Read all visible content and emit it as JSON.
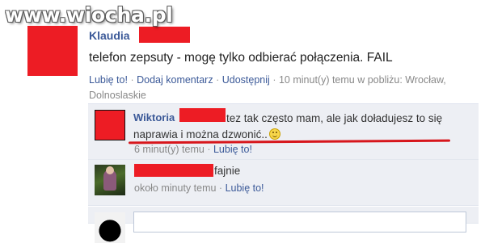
{
  "watermark": "www.wiocha.pl",
  "post": {
    "author": "Klaudia",
    "message": "telefon zepsuty - mogę tylko odbierać połączenia. FAIL",
    "actions": {
      "like": "Lubię to!",
      "comment": "Dodaj komentarz",
      "share": "Udostępnij"
    },
    "timestamp": "10 minut(y) temu w pobliżu: Wrocław, Dolnoslaskie",
    "separator": "·"
  },
  "comments": [
    {
      "author": "Wiktoria",
      "text": "tez tak często mam, ale jak doładujesz to się naprawia i można dzwonić..",
      "time": "6 minut(y) temu",
      "like": "Lubię to!"
    },
    {
      "author": "",
      "text": "fajnie",
      "time": "około minuty temu",
      "like": "Lubię to!"
    }
  ],
  "colors": {
    "link": "#3b5998",
    "redaction": "#ed1c24",
    "comment_bg": "#edeff4",
    "meta_text": "#888888"
  }
}
